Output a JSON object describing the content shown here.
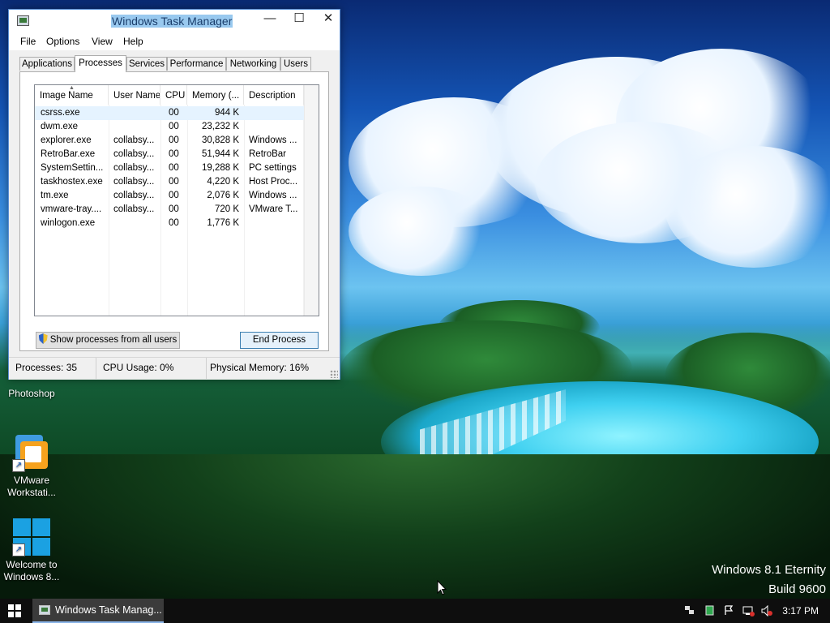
{
  "desktop": {
    "icons": [
      {
        "label": "Photoshop"
      },
      {
        "label": "VMware Workstati..."
      },
      {
        "label": "Welcome to Windows 8..."
      }
    ],
    "watermark_line1": "Windows 8.1 Eternity",
    "watermark_line2": "Build 9600"
  },
  "window": {
    "title": "Windows Task Manager",
    "controls": {
      "minimize": "—",
      "maximize": "☐",
      "close": "✕"
    },
    "menu": [
      "File",
      "Options",
      "View",
      "Help"
    ],
    "tabs": [
      "Applications",
      "Processes",
      "Services",
      "Performance",
      "Networking",
      "Users"
    ],
    "active_tab": "Processes",
    "columns": [
      "Image Name",
      "User Name",
      "CPU",
      "Memory (...",
      "Description"
    ],
    "processes": [
      {
        "name": "csrss.exe",
        "user": "",
        "cpu": "00",
        "memory": "944 K",
        "description": ""
      },
      {
        "name": "dwm.exe",
        "user": "",
        "cpu": "00",
        "memory": "23,232 K",
        "description": ""
      },
      {
        "name": "explorer.exe",
        "user": "collabsy...",
        "cpu": "00",
        "memory": "30,828 K",
        "description": "Windows ..."
      },
      {
        "name": "RetroBar.exe",
        "user": "collabsy...",
        "cpu": "00",
        "memory": "51,944 K",
        "description": "RetroBar"
      },
      {
        "name": "SystemSettin...",
        "user": "collabsy...",
        "cpu": "00",
        "memory": "19,288 K",
        "description": "PC settings"
      },
      {
        "name": "taskhostex.exe",
        "user": "collabsy...",
        "cpu": "00",
        "memory": "4,220 K",
        "description": "Host Proc..."
      },
      {
        "name": "tm.exe",
        "user": "collabsy...",
        "cpu": "00",
        "memory": "2,076 K",
        "description": "Windows ..."
      },
      {
        "name": "vmware-tray....",
        "user": "collabsy...",
        "cpu": "00",
        "memory": "720 K",
        "description": "VMware T..."
      },
      {
        "name": "winlogon.exe",
        "user": "",
        "cpu": "00",
        "memory": "1,776 K",
        "description": ""
      }
    ],
    "show_all_button": "Show processes from all users",
    "end_process_button": "End Process",
    "status": {
      "processes": "Processes: 35",
      "cpu": "CPU Usage: 0%",
      "memory": "Physical Memory: 16%"
    }
  },
  "taskbar": {
    "task_button": "Windows Task Manag...",
    "clock": "3:17 PM"
  },
  "colors": {
    "title_highlight": "#99c9ef",
    "selected_row": "#e5f3ff",
    "taskbar": "#0e0e0e"
  }
}
